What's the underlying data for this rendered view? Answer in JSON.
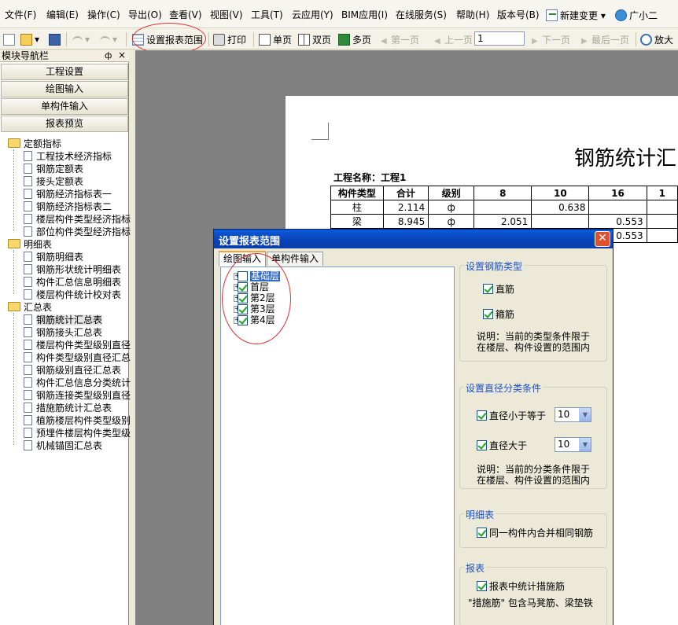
{
  "menu": [
    {
      "label": "文件(F)"
    },
    {
      "label": "编辑(E)"
    },
    {
      "label": "操作(C)"
    },
    {
      "label": "导出(O)"
    },
    {
      "label": "查看(V)"
    },
    {
      "label": "视图(V)"
    },
    {
      "label": "工具(T)"
    },
    {
      "label": "云应用(Y)"
    },
    {
      "label": "BIM应用(I)"
    },
    {
      "label": "在线服务(S)"
    },
    {
      "label": "帮助(H)"
    },
    {
      "label": "版本号(B)"
    },
    {
      "label": "新建变更"
    },
    {
      "label": "广小二"
    }
  ],
  "toolbar": {
    "set_range": "设置报表范围",
    "print": "打印",
    "single_page": "单页",
    "double_page": "双页",
    "multi_page": "多页",
    "first_page": "第一页",
    "prev_page": "上一页",
    "page_value": "1",
    "next_page": "下一页",
    "last_page": "最后一页",
    "zoom_in": "放大"
  },
  "panel": {
    "title": "模块导航栏",
    "pin": "ф",
    "close": "×",
    "nav_buttons": [
      "工程设置",
      "绘图输入",
      "单构件输入",
      "报表预览"
    ],
    "groups": [
      {
        "label": "定额指标",
        "items": [
          "工程技术经济指标",
          "钢筋定额表",
          "接头定额表",
          "钢筋经济指标表一",
          "钢筋经济指标表二",
          "楼层构件类型经济指标",
          "部位构件类型经济指标"
        ]
      },
      {
        "label": "明细表",
        "items": [
          "钢筋明细表",
          "钢筋形状统计明细表",
          "构件汇总信息明细表",
          "楼层构件统计校对表"
        ]
      },
      {
        "label": "汇总表",
        "items": [
          "钢筋统计汇总表",
          "钢筋接头汇总表",
          "楼层构件类型级别直径",
          "构件类型级别直径汇总",
          "钢筋级别直径汇总表",
          "构件汇总信息分类统计",
          "钢筋连接类型级别直径",
          "措施筋统计汇总表",
          "植筋楼层构件类型级别",
          "预埋件楼层构件类型级",
          "机械锚固汇总表"
        ]
      }
    ]
  },
  "report": {
    "title": "钢筋统计汇",
    "project": "工程名称：工程1",
    "headers": [
      "构件类型",
      "合计",
      "级别",
      "8",
      "10",
      "16",
      "1"
    ],
    "rows": [
      [
        "柱",
        "2.114",
        "ф",
        "",
        "0.638",
        "",
        ""
      ],
      [
        "梁",
        "8.945",
        "ф",
        "2.051",
        "",
        "0.553",
        ""
      ],
      [
        "",
        "",
        "",
        "",
        "",
        "0.553",
        ""
      ]
    ]
  },
  "dialog": {
    "title": "设置报表范围",
    "close": "✕",
    "tabs": [
      "绘图输入",
      "单构件输入"
    ],
    "floors": [
      {
        "label": "基础层",
        "checked": false,
        "selected": true
      },
      {
        "label": "首层",
        "checked": true
      },
      {
        "label": "第2层",
        "checked": true
      },
      {
        "label": "第3层",
        "checked": true
      },
      {
        "label": "第4层",
        "checked": true
      }
    ],
    "rebar_type": {
      "title": "设置钢筋类型",
      "straight": "直筋",
      "stirrup": "箍筋",
      "note_line1": "说明：当前的类型条件限于",
      "note_line2": "在楼层、构件设置的范围内"
    },
    "diameter": {
      "title": "设置直径分类条件",
      "le_label": "直径小于等于",
      "le_value": "10",
      "gt_label": "直径大于",
      "gt_value": "10",
      "note_line1": "说明：当前的分类条件限于",
      "note_line2": "在楼层、构件设置的范围内"
    },
    "detail": {
      "title": "明细表",
      "merge_label": "同一构件内合并相同钢筋"
    },
    "report": {
      "title": "报表",
      "measure_label": "报表中统计措施筋",
      "measure_note": "\"措施筋\" 包含马凳筋、梁垫铁"
    }
  }
}
